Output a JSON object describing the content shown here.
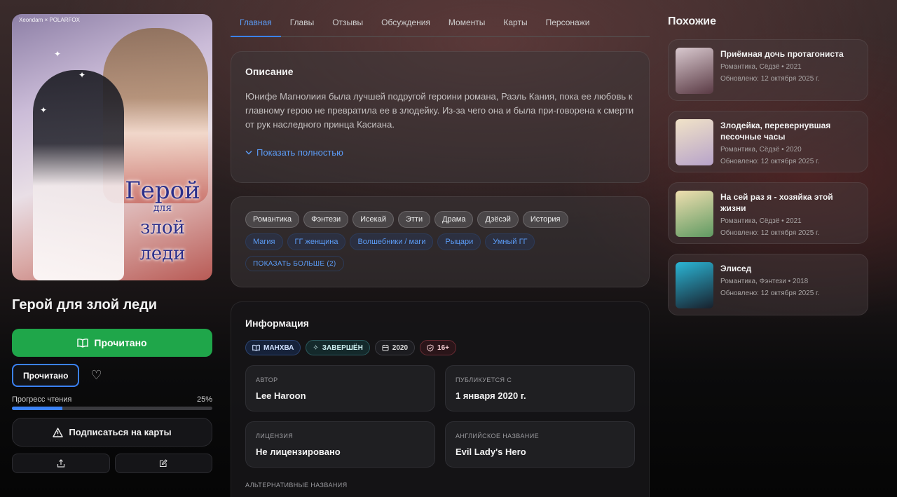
{
  "cover": {
    "credit": "Xeondam × POLARFOX",
    "title_line1": "Герой",
    "title_line2": "для",
    "title_line3": "злой леди"
  },
  "manga": {
    "title": "Герой для злой леди",
    "read_button": "Прочитано",
    "status_button": "Прочитано",
    "progress_label": "Прогресс чтения",
    "progress_value": "25%",
    "progress_fraction": 0.25,
    "subscribe_button": "Подписаться на карты"
  },
  "tabs": [
    {
      "label": "Главная",
      "active": true
    },
    {
      "label": "Главы"
    },
    {
      "label": "Отзывы"
    },
    {
      "label": "Обсуждения"
    },
    {
      "label": "Моменты"
    },
    {
      "label": "Карты"
    },
    {
      "label": "Персонажи"
    }
  ],
  "description": {
    "heading": "Описание",
    "text": "Юнифе Магнолиия была лучшей подругой героини романа, Раэль Кания, пока ее любовь к главному герою не превратила ее в злодейку. Из-за чего она и была при-говорена к смерти от рук наследного принца Касиана.",
    "show_more": "Показать полностью"
  },
  "tags": {
    "genres": [
      "Романтика",
      "Фэнтези",
      "Исекай",
      "Этти",
      "Драма",
      "Дзёсэй",
      "История"
    ],
    "tags": [
      "Магия",
      "ГГ женщина",
      "Волшебники / маги",
      "Рыцари",
      "Умный ГГ"
    ],
    "show_more": "ПОКАЗАТЬ БОЛЬШЕ (2)"
  },
  "info": {
    "heading": "Информация",
    "badges": {
      "type": "МАНХВА",
      "status": "ЗАВЕРШЁН",
      "year": "2020",
      "age": "16+"
    },
    "fields": [
      {
        "label": "АВТОР",
        "value": "Lee Haroon"
      },
      {
        "label": "ПУБЛИКУЕТСЯ С",
        "value": "1 января 2020 г."
      },
      {
        "label": "ЛИЦЕНЗИЯ",
        "value": "Не лицензировано"
      },
      {
        "label": "АНГЛИЙСКОЕ НАЗВАНИЕ",
        "value": "Evil Lady's Hero"
      }
    ],
    "alt_names_label": "АЛЬТЕРНАТИВНЫЕ НАЗВАНИЯ"
  },
  "similar": {
    "heading": "Похожие",
    "items": [
      {
        "title": "Приёмная дочь протагониста",
        "meta": "Романтика, Сёдзё • 2021",
        "updated": "Обновлено: 12 октября 2025 г.",
        "color1": "#d9c9cf",
        "color2": "#5a3a44"
      },
      {
        "title": "Злодейка, перевернувшая песочные часы",
        "meta": "Романтика, Сёдзё • 2020",
        "updated": "Обновлено: 12 октября 2025 г.",
        "color1": "#f1e3c8",
        "color2": "#b7a3c9"
      },
      {
        "title": "На сей раз я - хозяйка этой жизни",
        "meta": "Романтика, Сёдзё • 2021",
        "updated": "Обновлено: 12 октября 2025 г.",
        "color1": "#f0dfb0",
        "color2": "#5f9a62"
      },
      {
        "title": "Элисед",
        "meta": "Романтика, Фэнтези • 2018",
        "updated": "Обновлено: 12 октября 2025 г.",
        "color1": "#2bb6d6",
        "color2": "#18202c"
      }
    ]
  },
  "colors": {
    "accent": "#3b82f6",
    "read_green": "#1fa64a"
  }
}
